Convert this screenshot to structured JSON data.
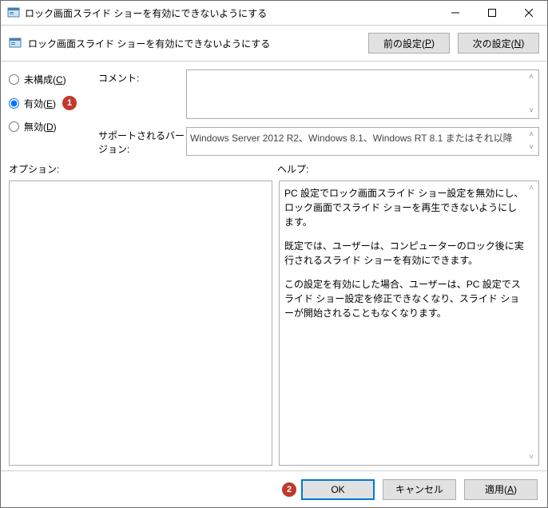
{
  "window": {
    "title": "ロック画面スライド ショーを有効にできないようにする"
  },
  "header": {
    "title": "ロック画面スライド ショーを有効にできないようにする",
    "prev_label_pre": "前の設定(",
    "prev_label_key": "P",
    "prev_label_post": ")",
    "next_label_pre": "次の設定(",
    "next_label_key": "N",
    "next_label_post": ")"
  },
  "radios": {
    "not_configured_pre": "未構成(",
    "not_configured_key": "C",
    "not_configured_post": ")",
    "enabled_pre": "有効(",
    "enabled_key": "E",
    "enabled_post": ")",
    "disabled_pre": "無効(",
    "disabled_key": "D",
    "disabled_post": ")"
  },
  "fields": {
    "comment_label": "コメント:",
    "comment_value": "",
    "support_label": "サポートされるバージョン:",
    "support_value": "Windows Server 2012 R2、Windows 8.1、Windows RT 8.1 またはそれ以降"
  },
  "sections": {
    "options_label": "オプション:",
    "help_label": "ヘルプ:"
  },
  "help": {
    "p1": "PC 設定でロック画面スライド ショー設定を無効にし、ロック画面でスライド ショーを再生できないようにします。",
    "p2": "既定では、ユーザーは、コンピューターのロック後に実行されるスライド ショーを有効にできます。",
    "p3": "この設定を有効にした場合、ユーザーは、PC 設定でスライド ショー設定を修正できなくなり、スライド ショーが開始されることもなくなります。"
  },
  "footer": {
    "ok": "OK",
    "cancel": "キャンセル",
    "apply_pre": "適用(",
    "apply_key": "A",
    "apply_post": ")"
  },
  "callouts": {
    "one": "1",
    "two": "2"
  }
}
